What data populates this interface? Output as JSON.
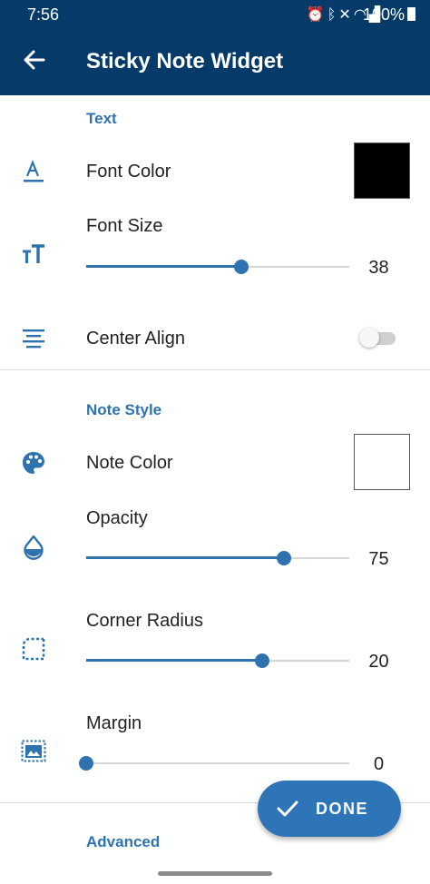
{
  "status_bar": {
    "time": "7:56",
    "battery_percent": "100%",
    "icons": [
      "alarm-icon",
      "bluetooth-icon",
      "mute-icon",
      "wifi-icon",
      "signal-icon",
      "battery-icon"
    ]
  },
  "app_bar": {
    "title": "Sticky Note Widget",
    "back_icon": "arrow-back-icon",
    "color": "#063b69"
  },
  "accent_color": "#2e73b0",
  "sections": {
    "text": {
      "title": "Text",
      "font_color": {
        "label": "Font Color",
        "swatch_color": "#000000"
      },
      "font_size": {
        "label": "Font Size",
        "value": "38",
        "fraction": 0.59
      },
      "center_align": {
        "label": "Center Align",
        "enabled": false
      }
    },
    "note_style": {
      "title": "Note Style",
      "note_color": {
        "label": "Note Color",
        "swatch_color": "#ffffff"
      },
      "opacity": {
        "label": "Opacity",
        "value": "75",
        "fraction": 0.75
      },
      "corner_radius": {
        "label": "Corner Radius",
        "value": "20",
        "fraction": 0.67
      },
      "margin": {
        "label": "Margin",
        "value": "0",
        "fraction": 0.0
      }
    },
    "advanced": {
      "title": "Advanced"
    }
  },
  "fab": {
    "label": "DONE",
    "icon": "check-icon"
  }
}
